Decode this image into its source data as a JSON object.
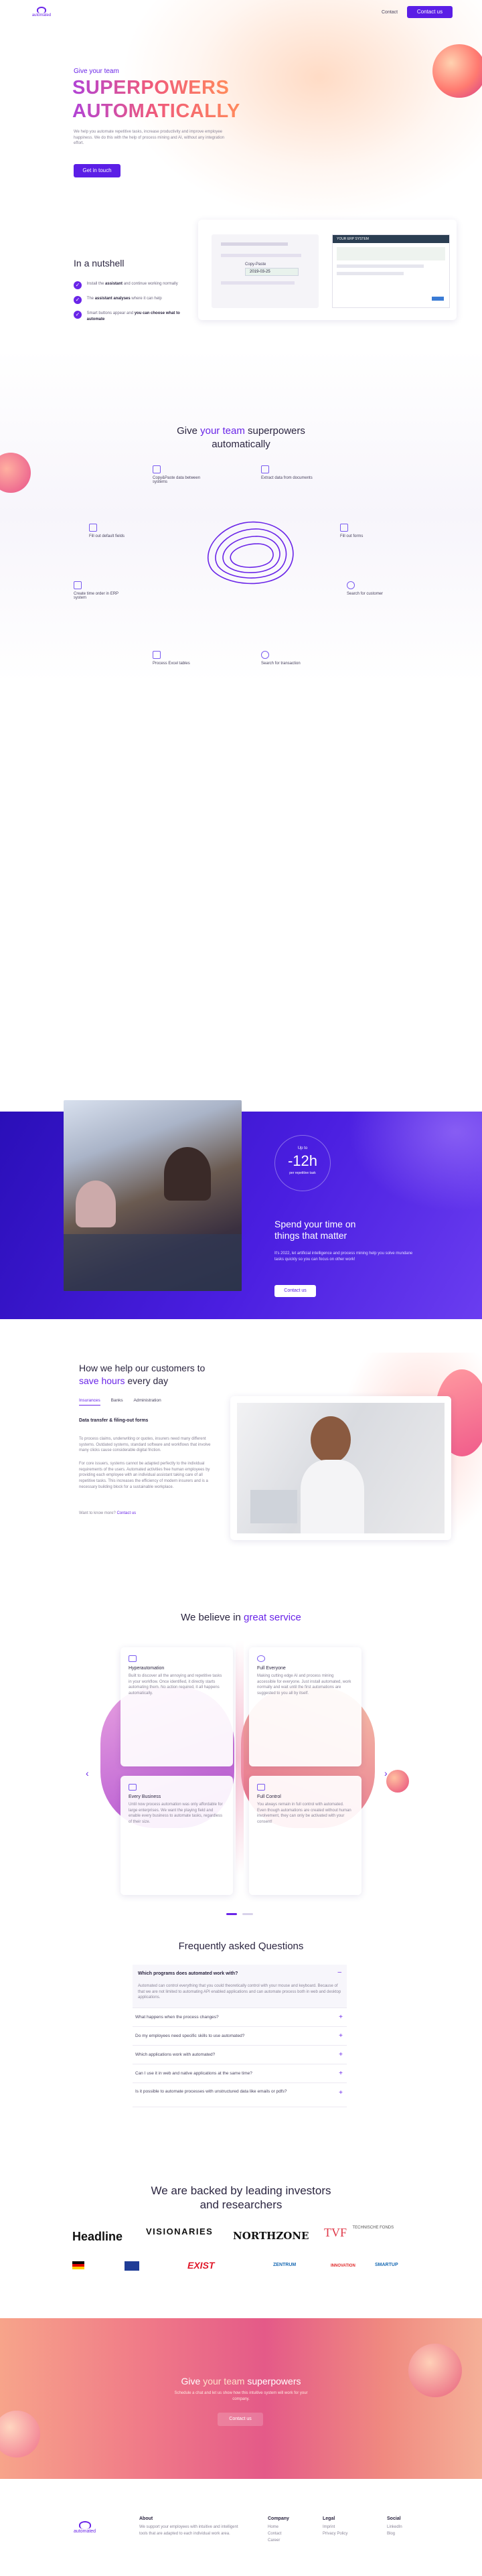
{
  "header": {
    "brand": "automated",
    "contact": "Contact",
    "cta": "Contact us"
  },
  "hero": {
    "eyebrow": "Give your team",
    "line1": "SUPERPOWERS",
    "line2": "AUTOMATICALLY",
    "body": "We help you automate repetitive tasks, increase productivity and improve employee happiness. We do this with the help of process mining and AI, without any integration effort.",
    "cta": "Get in touch"
  },
  "nutshell": {
    "title": "In a nutshell",
    "items": [
      {
        "lead": "Install the ",
        "bold": "assistant",
        "rest": " and continue working normally"
      },
      {
        "lead": "The ",
        "bold": "assistant analyses",
        "rest": " where it can help"
      },
      {
        "lead": "Smart buttons appear and ",
        "bold": "you can choose what to automate",
        "rest": ""
      }
    ],
    "mock_label": "Copy-Paste",
    "mock_value": "2019-03-25",
    "mock_header": "YOUR ERP SYSTEM"
  },
  "superpowers": {
    "pre": "Give ",
    "accent": "your team",
    "post": " superpowers",
    "line2": "automatically",
    "features": [
      {
        "icon": "copy-icon",
        "label": "Copy&Paste data between systems"
      },
      {
        "icon": "extract-icon",
        "label": "Extract data from documents"
      },
      {
        "icon": "form-icon",
        "label": "Fill out default fields"
      },
      {
        "icon": "form-icon",
        "label": "Fill out forms"
      },
      {
        "icon": "order-icon",
        "label": "Create time order in ERP system"
      },
      {
        "icon": "search-icon",
        "label": "Search for customer"
      },
      {
        "icon": "excel-icon",
        "label": "Process Excel tables"
      },
      {
        "icon": "search-icon",
        "label": "Search for transaction"
      }
    ]
  },
  "save": {
    "up_to": "Up to",
    "hours": "-12h",
    "per": "per repetitive task",
    "title1": "Spend your time on",
    "title2": "things that matter",
    "body": "It's 2022, let artificial intelligence and process mining help you solve mundane tasks quickly so you can focus on other work!",
    "cta": "Contact us"
  },
  "help": {
    "title1": "How we help our customers to",
    "accent": "save hours",
    "title2": " every day",
    "tabs": [
      "Insurances",
      "Banks",
      "Administration"
    ],
    "subtitle": "Data transfer & filing-out forms",
    "p1": "To process claims, underwriting or quotes, insurers need many different systems. Outdated systems, standard software and workflows that involve many clicks cause considerable digital friction.",
    "p2": "For core issuers, systems cannot be adapted perfectly to the individual requirements of the users. Automated activities free human employees by providing each employee with an individual assistant taking care of all repetitive tasks. This increases the efficiency of modern insurers and is a necessary building block for a sustainable workplace.",
    "more_pre": "Want to know more? ",
    "more_link": "Contact us"
  },
  "service": {
    "pre": "We believe in ",
    "accent": "great service",
    "cards": [
      {
        "title": "Hyperautomation",
        "body": "Built to discover all the annoying and repetitive tasks in your workflow. Once identified, it directly starts automating them. No action required, it all happens automatically."
      },
      {
        "title": "Full Everyone",
        "body": "Making cutting edge AI and process mining accessible for everyone. Just install automated, work normally and wait until the first automations are suggested to you all by itself."
      },
      {
        "title": "Every Business",
        "body": "Until now process automation was only affordable for large enterprises. We want the playing field and enable every business to automate tasks, regardless of their size."
      },
      {
        "title": "Full Control",
        "body": "You always remain in full control with automated. Even though automations are created without human involvement, they can only be activated with your consent!"
      }
    ]
  },
  "faq": {
    "title": "Frequently asked Questions",
    "open_q": "Which programs does automated work with?",
    "open_a": "Automated can control everything that you could theoretically control with your mouse and keyboard. Because of that we are not limited to automating API enabled applications and can automate process both in web and desktop applications.",
    "items": [
      "What happens when the process changes?",
      "Do my employees need specific skills to use automated?",
      "Which applications work with automated?",
      "Can I use it in web and native applications at the same time?",
      "Is it possible to automate processes with unstructured data like emails or pdfs?"
    ]
  },
  "backed": {
    "line1": "We are backed by leading investors",
    "line2": "and researchers",
    "logos": [
      "Headline",
      "VISIONARIES",
      "NORTHZONE",
      "TECHNISCHE FONDS"
    ],
    "sub_logos": [
      "EXIST",
      "ZENTRUM",
      "INNOVATION",
      "SMARTUP"
    ]
  },
  "cta_band": {
    "pre": "Give ",
    "accent": "your team",
    "post": " superpowers",
    "body": "Schedule a chat and let us show how this intuitive system will work for your company.",
    "btn": "Contact us"
  },
  "footer": {
    "brand": "automated",
    "about_h": "About",
    "about": "We support your employees with intuitive and intelligent tools that are adapted to each individual work area.",
    "company_h": "Company",
    "company": [
      "Home",
      "Contact",
      "Career"
    ],
    "legal_h": "Legal",
    "legal": [
      "Imprint",
      "Privacy Policy"
    ],
    "social_h": "Social",
    "social": [
      "LinkedIn",
      "Blog"
    ]
  }
}
